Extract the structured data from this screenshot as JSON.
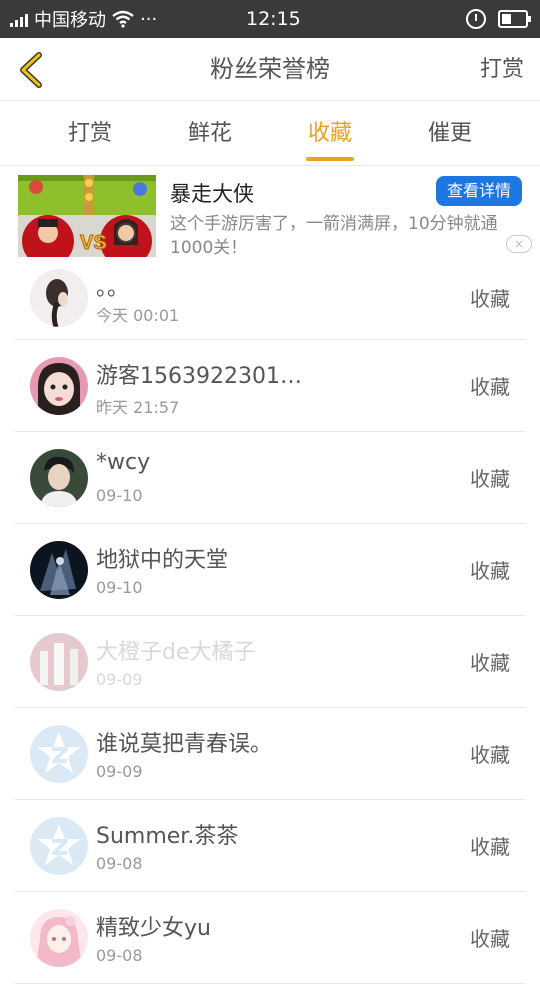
{
  "status_bar": {
    "carrier": "中国移动",
    "dots": "···",
    "time": "12:15"
  },
  "navbar": {
    "title": "粉丝荣誉榜",
    "action_label": "打赏"
  },
  "tabs": [
    {
      "label": "打赏",
      "active": false
    },
    {
      "label": "鲜花",
      "active": false
    },
    {
      "label": "收藏",
      "active": true
    },
    {
      "label": "催更",
      "active": false
    }
  ],
  "ad": {
    "title": "暴走大侠",
    "button_label": "查看详情",
    "description": "这个手游厉害了，一箭消满屏，10分钟就通1000关！",
    "close_symbol": "×"
  },
  "fans": [
    {
      "name": "。。",
      "date": "今天 00:01",
      "action": "收藏"
    },
    {
      "name": "游客1563922301…",
      "date": "昨天 21:57",
      "action": "收藏"
    },
    {
      "name": "*wcy",
      "date": "09-10",
      "action": "收藏"
    },
    {
      "name": "地狱中的天堂",
      "date": "09-10",
      "action": "收藏"
    },
    {
      "name": "大橙子de大橘子",
      "date": "09-09",
      "action": "收藏"
    },
    {
      "name": "谁说莫把青春误。",
      "date": "09-09",
      "action": "收藏"
    },
    {
      "name": "Summer.茶茶",
      "date": "09-08",
      "action": "收藏"
    },
    {
      "name": "精致少女yu",
      "date": "09-08",
      "action": "收藏"
    }
  ],
  "colors": {
    "accent": "#f0a020",
    "ad_button": "#1d77e0",
    "status_bar": "#3a3a3a"
  }
}
